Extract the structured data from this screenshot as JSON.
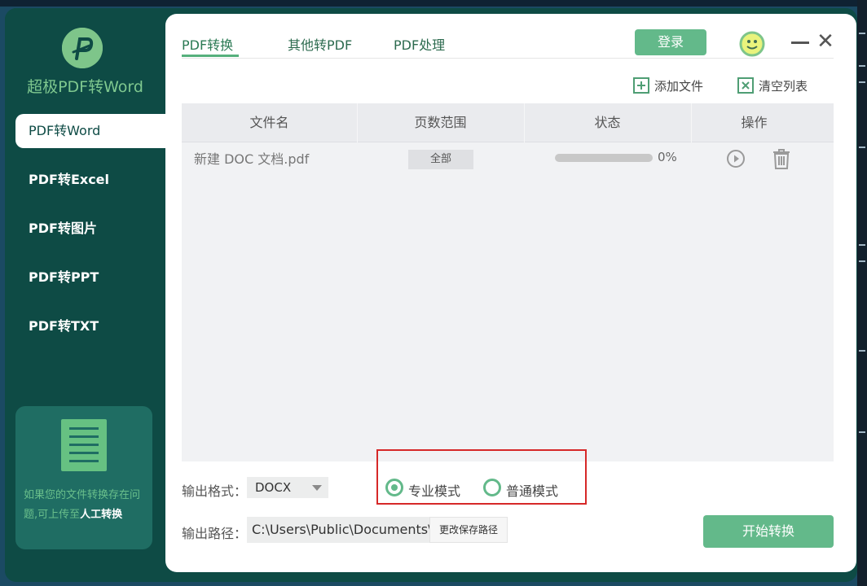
{
  "app": {
    "title": "超极PDF转Word"
  },
  "sidebar": {
    "items": [
      {
        "label": "PDF转Word"
      },
      {
        "label": "PDF转Excel"
      },
      {
        "label": "PDF转图片"
      },
      {
        "label": "PDF转PPT"
      },
      {
        "label": "PDF转TXT"
      }
    ],
    "help": {
      "text": "如果您的文件转换存在问题,可上传至",
      "link": "人工转换"
    }
  },
  "header": {
    "tabs": [
      {
        "label": "PDF转换"
      },
      {
        "label": "其他转PDF"
      },
      {
        "label": "PDF处理"
      }
    ],
    "login_label": "登录"
  },
  "toolbar": {
    "add_file_label": "添加文件",
    "clear_list_label": "清空列表"
  },
  "table": {
    "columns": [
      "文件名",
      "页数范围",
      "状态",
      "操作"
    ],
    "rows": [
      {
        "name": "新建 DOC 文档.pdf",
        "range": "全部",
        "progress_text": "0%",
        "progress": 0
      }
    ]
  },
  "output": {
    "format_label": "输出格式：",
    "format_value": "DOCX",
    "modes": [
      {
        "label": "专业模式",
        "selected": true
      },
      {
        "label": "普通模式",
        "selected": false
      }
    ],
    "path_label": "输出路径：",
    "path_value": "C:\\Users\\Public\\Documents\\",
    "change_path_label": "更改保存路径",
    "start_label": "开始转换"
  },
  "colors": {
    "sidebar_bg": "#0e4b45",
    "accent": "#63b98a",
    "highlight_box": "#d62828"
  }
}
